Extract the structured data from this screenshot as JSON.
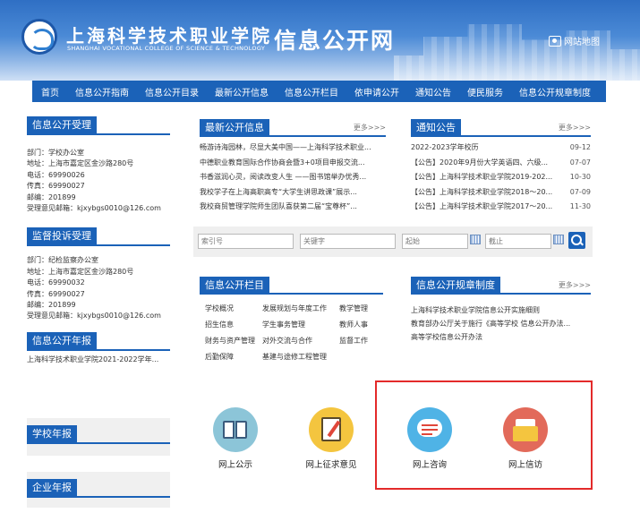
{
  "header": {
    "school_cn": "上海科学技术职业学院",
    "school_en": "SHANGHAI VOCATIONAL COLLEGE OF SCIENCE & TECHNOLOGY",
    "site_title": "信息公开网",
    "sitemap_label": "网站地图"
  },
  "nav": [
    "首页",
    "信息公开指南",
    "信息公开目录",
    "最新公开信息",
    "信息公开栏目",
    "依申请公开",
    "通知公告",
    "便民服务",
    "信息公开规章制度"
  ],
  "left": {
    "accept": {
      "title": "信息公开受理",
      "lines": [
        "部门：学校办公室",
        "地址：上海市嘉定区金沙路280号",
        "电话：69990026",
        "传真：69990027",
        "邮编：201899",
        "受理意见邮箱：kjxybgs0010@126.com"
      ]
    },
    "complaint": {
      "title": "监督投诉受理",
      "lines": [
        "部门：纪检监察办公室",
        "地址：上海市嘉定区金沙路280号",
        "电话：69990032",
        "传真：69990027",
        "邮编：201899",
        "受理意见邮箱：kjxybgs0010@126.com"
      ]
    },
    "annual": {
      "title": "信息公开年报",
      "item": "上海科学技术职业学院2021-2022学年..."
    },
    "school_report": {
      "title": "学校年报"
    },
    "enterprise_report": {
      "title": "企业年报"
    }
  },
  "latest": {
    "title": "最新公开信息",
    "more": "更多>>>",
    "items": [
      "畅游诗海园林，尽显大美中国——上海科学技术职业...",
      "中德职业教育国际合作协商会暨3+0项目申报交流...",
      "书香滋润心灵，阅读改变人生 ——图书馆举办优秀...",
      "我校学子在上海高职高专“大学生讲思政课”展示...",
      "我校商贸管理学院师生团队喜获第二届“宝尊杯”..."
    ]
  },
  "notice": {
    "title": "通知公告",
    "more": "更多>>>",
    "items": [
      {
        "t": "2022-2023学年校历",
        "d": "09-12"
      },
      {
        "t": "【公告】2020年9月份大学英语四、六级...",
        "d": "07-07"
      },
      {
        "t": "【公告】上海科学技术职业学院2019-202...",
        "d": "10-30"
      },
      {
        "t": "【公告】上海科学技术职业学院2018～20...",
        "d": "07-09"
      },
      {
        "t": "【公告】上海科学技术职业学院2017～20...",
        "d": "11-30"
      }
    ]
  },
  "search": {
    "f1": "索引号",
    "f2": "关键字",
    "f3": "起始",
    "f4": "截止"
  },
  "columns": {
    "title": "信息公开栏目",
    "items": [
      "学校概况",
      "发展规划与年度工作",
      "教学管理",
      "招生信息",
      "学生事务管理",
      "教师人事",
      "财务与资产管理",
      "对外交流与合作",
      "监督工作",
      "后勤保障",
      "基建与途修工程管理"
    ]
  },
  "rules": {
    "title": "信息公开规章制度",
    "more": "更多>>>",
    "items": [
      "上海科学技术职业学院信息公开实施细则",
      "教育部办公厅关于施行《高等学校 信息公开办法...",
      "高等学校信息公开办法"
    ]
  },
  "services": [
    "网上公示",
    "网上征求意见",
    "网上咨询",
    "网上信访"
  ],
  "colors": {
    "primary": "#1b62b8",
    "highlight": "#e32a2a"
  }
}
